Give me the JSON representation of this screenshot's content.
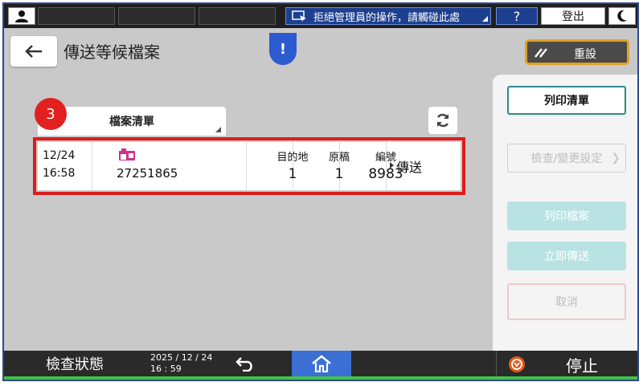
{
  "topbar": {
    "notice": "拒絕管理員的操作，請觸碰此處",
    "help": "?",
    "logout": "登出"
  },
  "header": {
    "title": "傳送等候檔案",
    "alert": "!",
    "reset": "重設"
  },
  "content": {
    "step_badge": "3",
    "list_tab": "檔案清單",
    "row": {
      "date": "12/24",
      "time": "16:58",
      "destination_number": "27251865",
      "dest_header": "目的地",
      "dest_value": "1",
      "orig_header": "原稿",
      "orig_value": "1",
      "id_header": "編號",
      "id_value": "8983",
      "status": "傳送"
    }
  },
  "sidebar": {
    "print_list": "列印清單",
    "check_change": "檢查/變更設定",
    "print_file": "列印檔案",
    "send_now": "立即傳送",
    "cancel": "取消"
  },
  "bottombar": {
    "status": "檢查狀態",
    "date": "2025 / 12 / 24",
    "time": "16 : 59",
    "stop": "停止"
  },
  "colors": {
    "accent_blue": "#2c5bcf",
    "highlight_red": "#e01b1b",
    "reset_border": "#e0a125",
    "teal_button": "#b9e2e2",
    "status_green": "#43c34a"
  }
}
